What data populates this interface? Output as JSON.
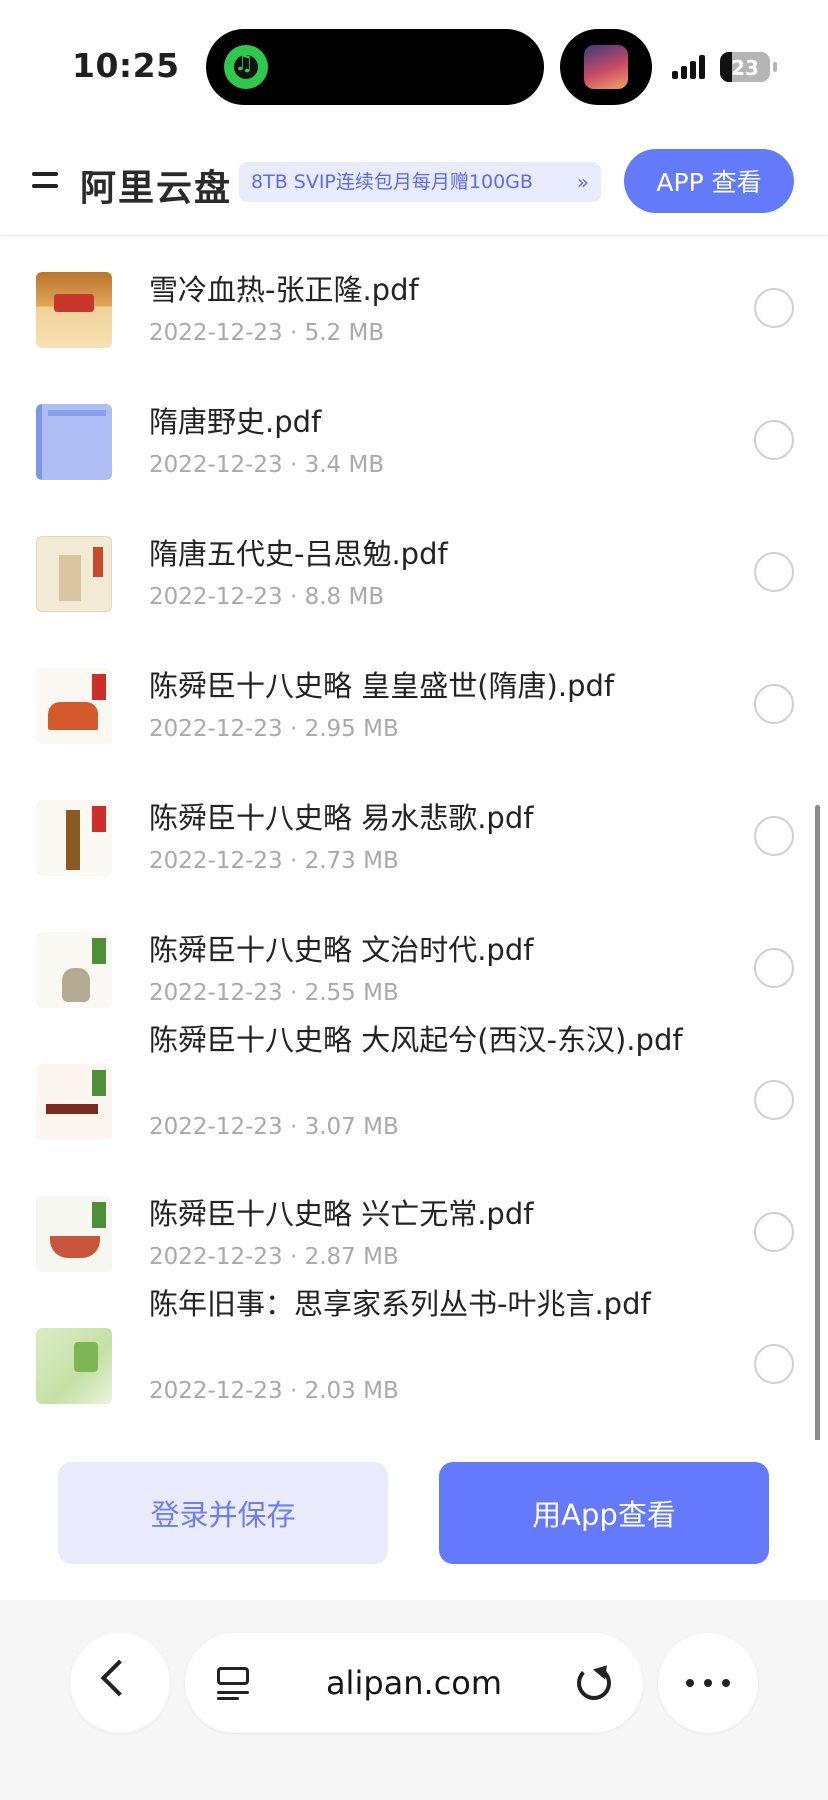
{
  "status_bar": {
    "time": "10:25",
    "battery": "23",
    "battery_level": 0.23
  },
  "header": {
    "brand": "阿里云盘",
    "promo": "8TB SVIP连续包月每月赠100GB",
    "promo_chevron": "»",
    "app_button": "APP 查看"
  },
  "files": [
    {
      "name": "雪冷血热-张正隆.pdf",
      "date": "2022-12-23",
      "size": "5.2 MB"
    },
    {
      "name": "隋唐野史.pdf",
      "date": "2022-12-23",
      "size": "3.4 MB"
    },
    {
      "name": "隋唐五代史-吕思勉.pdf",
      "date": "2022-12-23",
      "size": "8.8 MB"
    },
    {
      "name": "陈舜臣十八史略 皇皇盛世(隋唐).pdf",
      "date": "2022-12-23",
      "size": "2.95 MB"
    },
    {
      "name": "陈舜臣十八史略 易水悲歌.pdf",
      "date": "2022-12-23",
      "size": "2.73 MB"
    },
    {
      "name": "陈舜臣十八史略 文治时代.pdf",
      "date": "2022-12-23",
      "size": "2.55 MB"
    },
    {
      "name": "陈舜臣十八史略 大风起兮(西汉-东汉).pdf",
      "date": "2022-12-23",
      "size": "3.07 MB"
    },
    {
      "name": "陈舜臣十八史略 兴亡无常.pdf",
      "date": "2022-12-23",
      "size": "2.87 MB"
    },
    {
      "name": "陈年旧事：思享家系列丛书-叶兆言.pdf",
      "date": "2022-12-23",
      "size": "2.03 MB"
    }
  ],
  "meta_separator": " · ",
  "actions": {
    "login_save": "登录并保存",
    "open_app": "用App查看"
  },
  "browser": {
    "url": "alipan.com"
  },
  "colors": {
    "accent": "#637bfb",
    "accent_light": "#e9ebfd",
    "meta_text": "#a9a9a9"
  },
  "icons": [
    "music-icon",
    "menu-icon",
    "back-icon",
    "tabs-icon",
    "reload-icon",
    "more-icon"
  ]
}
